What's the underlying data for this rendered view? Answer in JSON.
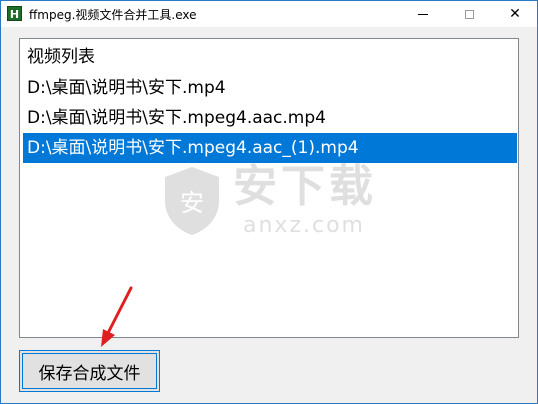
{
  "window": {
    "title": "ffmpeg.视频文件合并工具.exe",
    "icon_label": "H"
  },
  "titlebar_buttons": {
    "minimize_icon": "minimize-icon",
    "maximize_icon": "maximize-icon",
    "close_glyph": "✕"
  },
  "list": {
    "header": "视频列表",
    "items": [
      {
        "label": "D:\\桌面\\说明书\\安下.mp4",
        "selected": false
      },
      {
        "label": "D:\\桌面\\说明书\\安下.mpeg4.aac.mp4",
        "selected": false
      },
      {
        "label": "D:\\桌面\\说明书\\安下.mpeg4.aac_(1).mp4",
        "selected": true
      }
    ]
  },
  "buttons": {
    "save_label": "保存合成文件"
  },
  "watermark": {
    "text": "安下载",
    "sub": "anxz.com",
    "shield_glyph": "安"
  },
  "colors": {
    "selection": "#0078d7",
    "window_border": "#2b79c2",
    "arrow": "#e02020"
  }
}
